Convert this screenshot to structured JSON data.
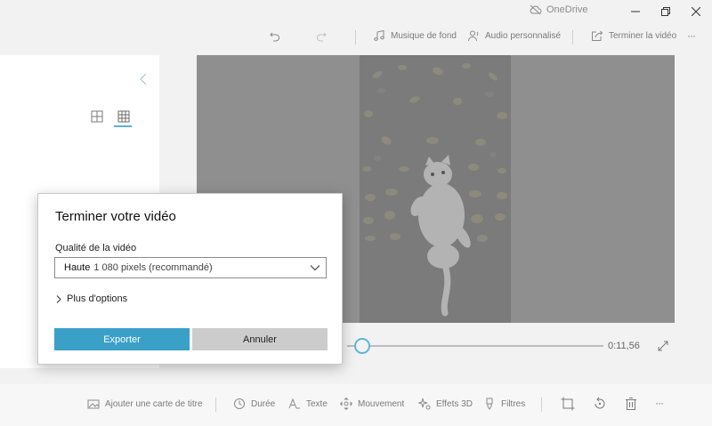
{
  "titlebar": {
    "onedrive_label": "OneDrive",
    "icons": [
      "cloud-off-icon",
      "minimize-icon",
      "maximize-icon",
      "close-icon"
    ]
  },
  "toolbar": {
    "music_label": "Musique de fond",
    "audio_label": "Audio personnalisé",
    "finish_label": "Terminer la vidéo",
    "more_label": "···"
  },
  "player": {
    "time": "0:11,56",
    "progress": 0.03
  },
  "bottombar": {
    "title_card_label": "Ajouter une carte de titre",
    "duration_label": "Durée",
    "text_label": "Texte",
    "motion_label": "Mouvement",
    "effects3d_label": "Effets 3D",
    "filters_label": "Filtres",
    "more_label": "···"
  },
  "dialog": {
    "title": "Terminer votre vidéo",
    "quality_label": "Qualité de la vidéo",
    "quality_value_main": "Haute",
    "quality_value_rest": "1 080 pixels (recommandé)",
    "more_options_label": "Plus d'options",
    "export_label": "Exporter",
    "cancel_label": "Annuler"
  },
  "colors": {
    "accent": "#3aa0c8",
    "cancel": "#cccccc",
    "overlay_gray": "#8f8f8f"
  }
}
